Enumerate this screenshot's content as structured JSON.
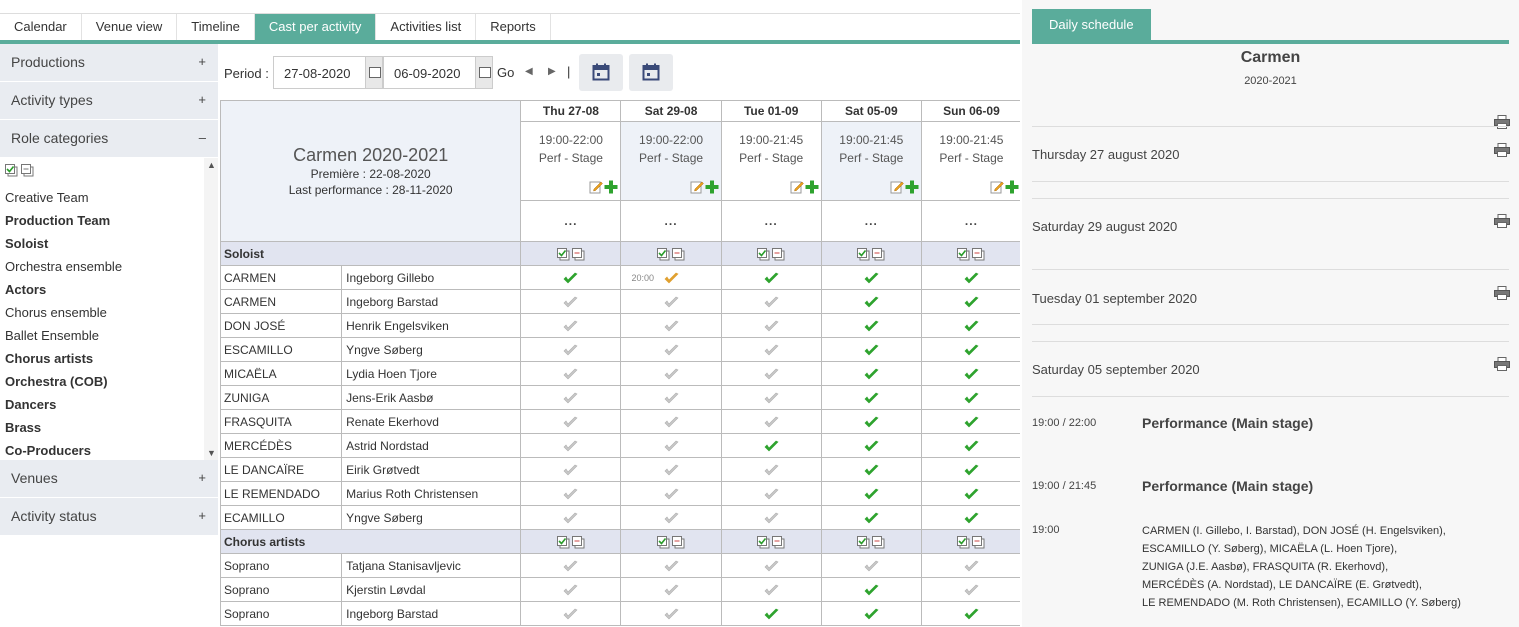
{
  "tabs": [
    {
      "label": "Calendar",
      "active": false
    },
    {
      "label": "Venue view",
      "active": false
    },
    {
      "label": "Timeline",
      "active": false
    },
    {
      "label": "Cast per activity",
      "active": true
    },
    {
      "label": "Activities list",
      "active": false
    },
    {
      "label": "Reports",
      "active": false
    }
  ],
  "accent_color": "#5aac9b",
  "sidebar": {
    "sections_top": [
      {
        "label": "Productions",
        "sign": "+"
      },
      {
        "label": "Activity types",
        "sign": "+"
      },
      {
        "label": "Role categories",
        "sign": "–"
      }
    ],
    "role_categories": [
      {
        "label": "Creative Team",
        "bold": false
      },
      {
        "label": "Production Team",
        "bold": true
      },
      {
        "label": "Soloist",
        "bold": true
      },
      {
        "label": "Orchestra ensemble",
        "bold": false
      },
      {
        "label": "Actors",
        "bold": true
      },
      {
        "label": "Chorus ensemble",
        "bold": false
      },
      {
        "label": "Ballet Ensemble",
        "bold": false
      },
      {
        "label": "Chorus artists",
        "bold": true
      },
      {
        "label": "Orchestra (COB)",
        "bold": true
      },
      {
        "label": "Dancers",
        "bold": true
      },
      {
        "label": "Brass",
        "bold": true
      },
      {
        "label": "Co-Producers",
        "bold": true
      }
    ],
    "sections_bottom": [
      {
        "label": "Venues",
        "sign": "+"
      },
      {
        "label": "Activity status",
        "sign": "+"
      }
    ]
  },
  "period": {
    "label": "Period :",
    "from": "27-08-2020",
    "to": "06-09-2020",
    "go": "Go",
    "separator": "|"
  },
  "production": {
    "title": "Carmen 2020-2021",
    "premiere": "Première : 22-08-2020",
    "last": "Last performance : 28-11-2020"
  },
  "days": [
    {
      "label": "Thu 27-08",
      "time": "19:00-22:00",
      "activity": "Perf - Stage",
      "shade": false
    },
    {
      "label": "Sat 29-08",
      "time": "19:00-22:00",
      "activity": "Perf - Stage",
      "shade": true
    },
    {
      "label": "Tue 01-09",
      "time": "19:00-21:45",
      "activity": "Perf - Stage",
      "shade": false
    },
    {
      "label": "Sat 05-09",
      "time": "19:00-21:45",
      "activity": "Perf - Stage",
      "shade": true
    },
    {
      "label": "Sun 06-09",
      "time": "19:00-21:45",
      "activity": "Perf - Stage",
      "shade": false
    }
  ],
  "dots": "...",
  "groups": [
    {
      "name": "Soloist",
      "rows": [
        {
          "role": "CARMEN",
          "person": "Ingeborg Gillebo",
          "status": [
            "g",
            "o",
            "g",
            "g",
            "g"
          ],
          "note": [
            "",
            "20:00",
            "",
            "",
            ""
          ]
        },
        {
          "role": "CARMEN",
          "person": "Ingeborg Barstad",
          "status": [
            "x",
            "x",
            "x",
            "g",
            "g"
          ],
          "note": [
            "",
            "",
            "",
            "",
            ""
          ]
        },
        {
          "role": "DON JOSÉ",
          "person": "Henrik Engelsviken",
          "status": [
            "x",
            "x",
            "x",
            "g",
            "g"
          ],
          "note": [
            "",
            "",
            "",
            "",
            ""
          ]
        },
        {
          "role": "ESCAMILLO",
          "person": "Yngve Søberg",
          "status": [
            "x",
            "x",
            "x",
            "g",
            "g"
          ],
          "note": [
            "",
            "",
            "",
            "",
            ""
          ]
        },
        {
          "role": "MICAËLA",
          "person": "Lydia Hoen Tjore",
          "status": [
            "x",
            "x",
            "x",
            "g",
            "g"
          ],
          "note": [
            "",
            "",
            "",
            "",
            ""
          ]
        },
        {
          "role": "ZUNIGA",
          "person": "Jens-Erik Aasbø",
          "status": [
            "x",
            "x",
            "x",
            "g",
            "g"
          ],
          "note": [
            "",
            "",
            "",
            "",
            ""
          ]
        },
        {
          "role": "FRASQUITA",
          "person": "Renate Ekerhovd",
          "status": [
            "x",
            "x",
            "x",
            "g",
            "g"
          ],
          "note": [
            "",
            "",
            "",
            "",
            ""
          ]
        },
        {
          "role": "MERCÉDÈS",
          "person": "Astrid Nordstad",
          "status": [
            "x",
            "x",
            "g",
            "g",
            "g"
          ],
          "note": [
            "",
            "",
            "",
            "",
            ""
          ]
        },
        {
          "role": "LE DANCAÏRE",
          "person": "Eirik Grøtvedt",
          "status": [
            "x",
            "x",
            "x",
            "g",
            "g"
          ],
          "note": [
            "",
            "",
            "",
            "",
            ""
          ]
        },
        {
          "role": "LE REMENDADO",
          "person": "Marius Roth Christensen",
          "status": [
            "x",
            "x",
            "x",
            "g",
            "g"
          ],
          "note": [
            "",
            "",
            "",
            "",
            ""
          ]
        },
        {
          "role": "ECAMILLO",
          "person": "Yngve Søberg",
          "status": [
            "x",
            "x",
            "x",
            "g",
            "g"
          ],
          "note": [
            "",
            "",
            "",
            "",
            ""
          ]
        }
      ]
    },
    {
      "name": "Chorus artists",
      "rows": [
        {
          "role": "Soprano",
          "person": "Tatjana Stanisavljevic",
          "status": [
            "x",
            "x",
            "x",
            "x",
            "x"
          ],
          "note": [
            "",
            "",
            "",
            "",
            ""
          ]
        },
        {
          "role": "Soprano",
          "person": "Kjerstin Løvdal",
          "status": [
            "x",
            "x",
            "x",
            "g",
            "x"
          ],
          "note": [
            "",
            "",
            "",
            "",
            ""
          ]
        },
        {
          "role": "Soprano",
          "person": "Ingeborg Barstad",
          "status": [
            "x",
            "x",
            "g",
            "g",
            "g"
          ],
          "note": [
            "",
            "",
            "",
            "",
            ""
          ]
        }
      ]
    }
  ],
  "schedule": {
    "tab": "Daily schedule",
    "title": "Carmen",
    "season": "2020-2021",
    "days": [
      "Thursday 27 august 2020",
      "Saturday 29 august 2020",
      "Tuesday 01 september 2020",
      "Saturday 05 september 2020"
    ],
    "entries": [
      {
        "time": "19:00 / 22:00",
        "title": "Performance (Main stage)"
      },
      {
        "time": "19:00 / 21:45",
        "title": "Performance (Main stage)"
      }
    ],
    "cast_time": "19:00",
    "cast_lines": [
      "CARMEN (I. Gillebo, I. Barstad), DON JOSÉ (H. Engelsviken),",
      "ESCAMILLO (Y. Søberg), MICAËLA (L. Hoen Tjore),",
      "ZUNIGA (J.E. Aasbø), FRASQUITA (R. Ekerhovd),",
      "MERCÉDÈS (A. Nordstad), LE DANCAÏRE (E. Grøtvedt),",
      "LE REMENDADO (M. Roth Christensen), ECAMILLO (Y. Søberg)"
    ]
  }
}
